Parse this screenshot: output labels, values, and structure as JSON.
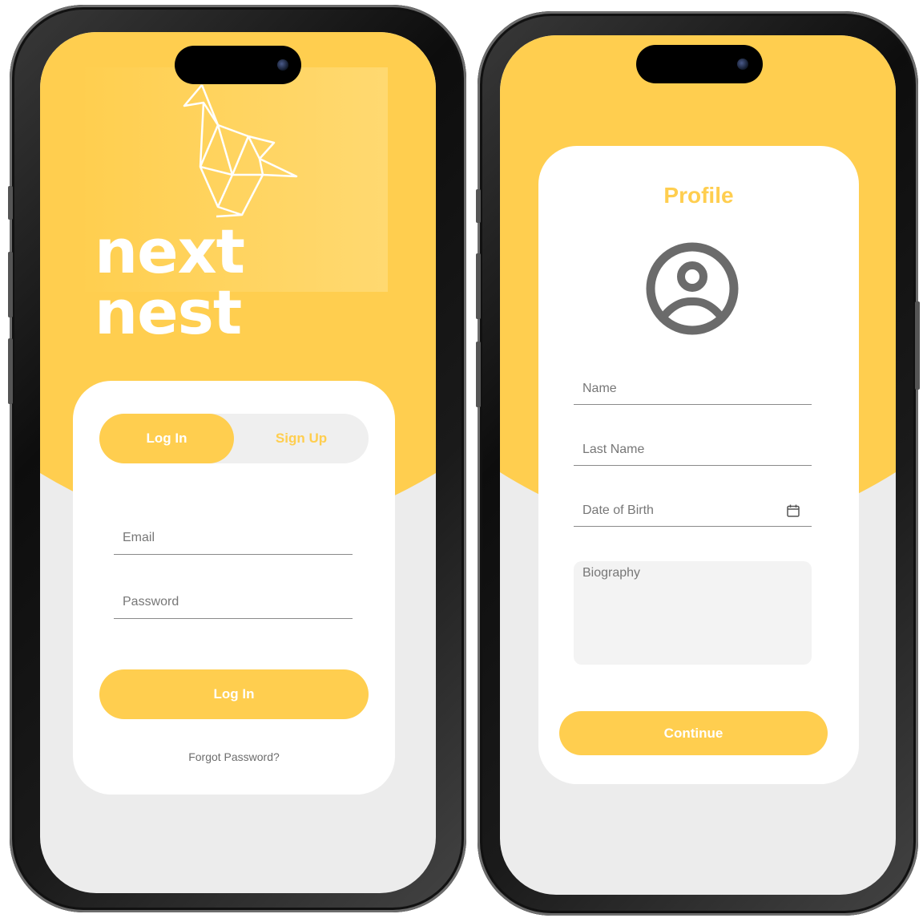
{
  "colors": {
    "accent": "#ffce4f",
    "background": "#ececec",
    "card": "#ffffff"
  },
  "login": {
    "logo_text": "next nest",
    "tabs": {
      "login_label": "Log In",
      "signup_label": "Sign Up"
    },
    "email_placeholder": "Email",
    "password_placeholder": "Password",
    "submit_label": "Log In",
    "forgot_label": "Forgot Password?"
  },
  "profile": {
    "title": "Profile",
    "name_placeholder": "Name",
    "last_name_placeholder": "Last Name",
    "dob_placeholder": "Date of Birth",
    "bio_placeholder": "Biography",
    "continue_label": "Continue",
    "avatar_icon": "account-circle-icon",
    "calendar_icon": "calendar-icon"
  }
}
